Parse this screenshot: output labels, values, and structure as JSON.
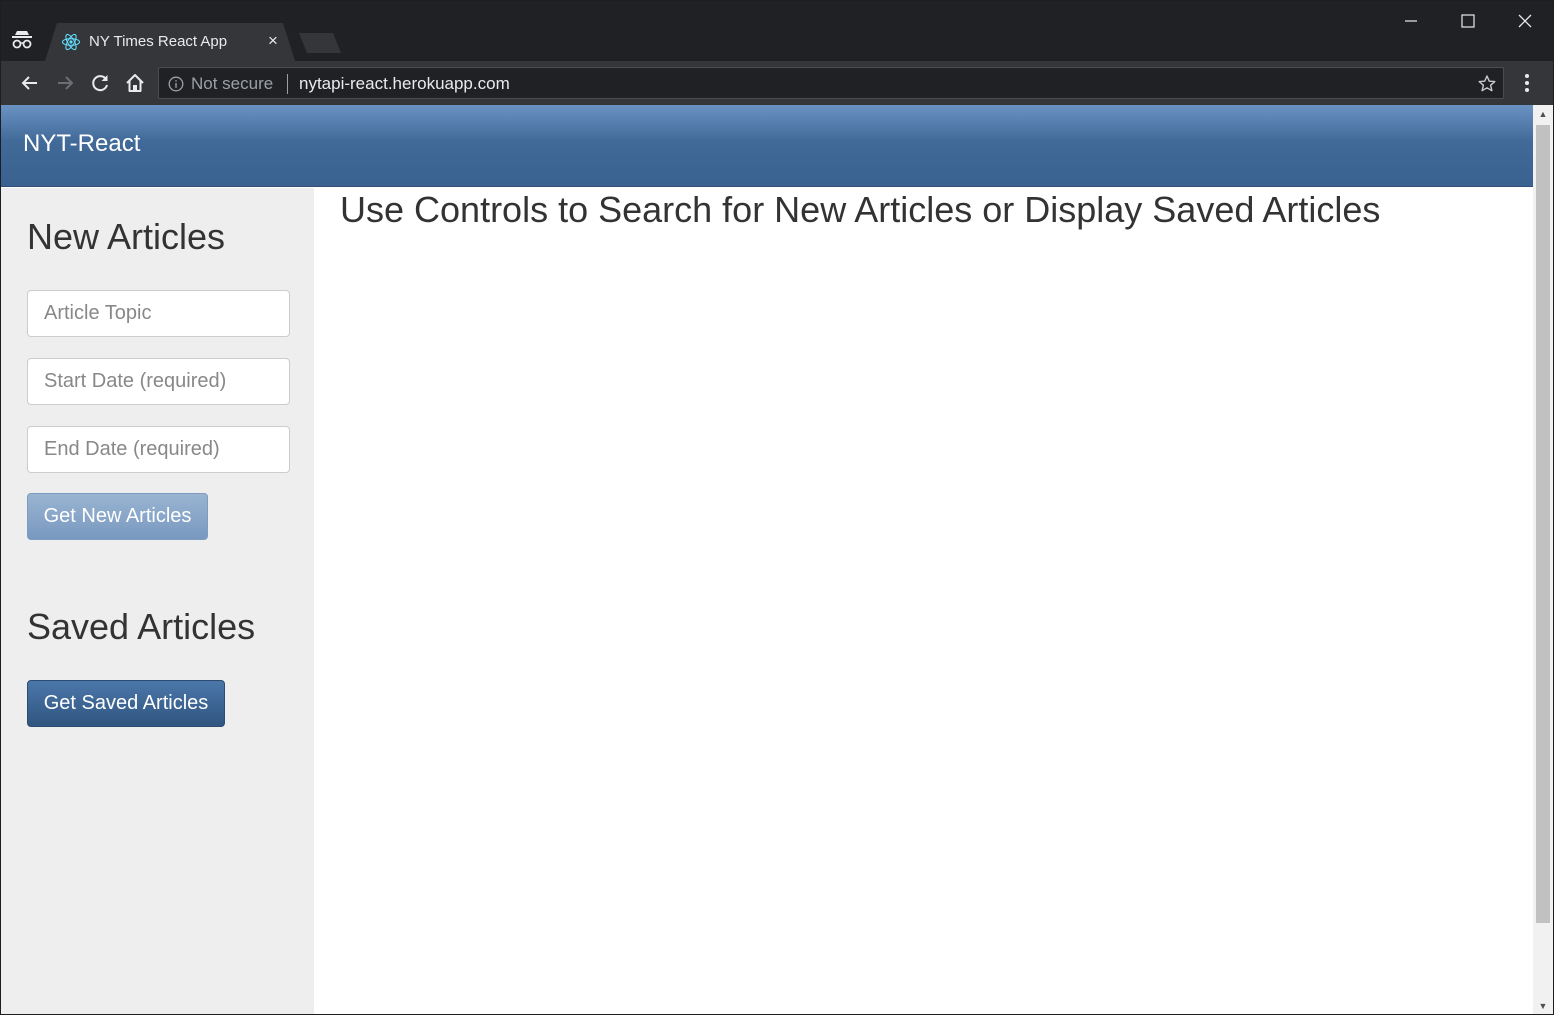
{
  "browser": {
    "tab_title": "NY Times React App",
    "tab_close": "×",
    "security_label": "Not secure",
    "url": "nytapi-react.herokuapp.com"
  },
  "navbar": {
    "brand": "NYT-React"
  },
  "sidebar": {
    "new_heading": "New Articles",
    "topic_placeholder": "Article Topic",
    "start_placeholder": "Start Date (required)",
    "end_placeholder": "End Date (required)",
    "new_button": "Get New Articles",
    "saved_heading": "Saved Articles",
    "saved_button": "Get Saved Articles"
  },
  "main": {
    "heading": "Use Controls to Search for New Articles or Display Saved Articles"
  },
  "icons": {
    "incognito": "incognito-icon",
    "favicon": "react-icon",
    "back": "arrow-left-icon",
    "forward": "arrow-right-icon",
    "reload": "reload-icon",
    "home": "home-icon",
    "info": "info-icon",
    "star": "star-icon",
    "menu": "kebab-menu-icon"
  },
  "colors": {
    "navbar": "#416a98",
    "sidebar": "#eeeeee",
    "primary_button": "#3a6190",
    "disabled_button": "#86a3c7",
    "react_blue": "#61dafb"
  }
}
